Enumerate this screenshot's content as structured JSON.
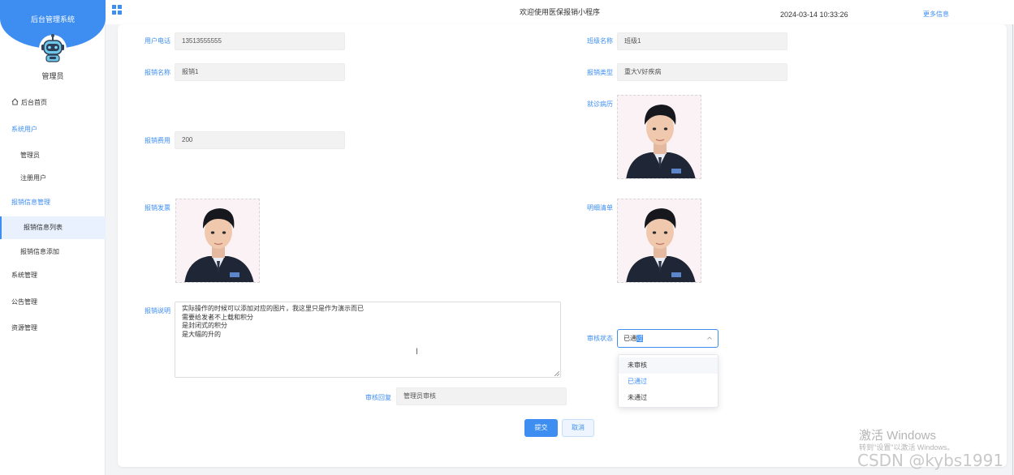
{
  "brand": {
    "title": "后台管理系统",
    "admin_name": "管理员"
  },
  "sidebar": {
    "items": [
      {
        "label": "后台首页"
      },
      {
        "label": "系统用户"
      },
      {
        "label": "管理员"
      },
      {
        "label": "注册用户"
      },
      {
        "label": "报销信息管理"
      },
      {
        "label": "报销信息列表"
      },
      {
        "label": "报销信息添加"
      },
      {
        "label": "系统管理"
      },
      {
        "label": "公告管理"
      },
      {
        "label": "资源管理"
      }
    ]
  },
  "topbar": {
    "welcome": "欢迎使用医保报销小程序",
    "datetime": "2024-03-14 10:33:26",
    "more_info": "更多信息"
  },
  "form": {
    "phone": {
      "label": "用户电话",
      "value": "13513555555"
    },
    "class": {
      "label": "班级名称",
      "value": "班级1"
    },
    "reimb_name": {
      "label": "报销名称",
      "value": "报销1"
    },
    "reimb_type": {
      "label": "报销类型",
      "value": "重大V好疾病"
    },
    "medical_record": {
      "label": "就诊病历"
    },
    "fee": {
      "label": "报销费用",
      "value": "200"
    },
    "invoice": {
      "label": "报销发票"
    },
    "detail_list": {
      "label": "明细清单"
    },
    "description": {
      "label": "报销说明",
      "lines": [
        "实际操作的时候可以添加对应的图片，我这里只是作为演示而已",
        "需要给发者不上载和积分",
        "是封闭式的积分",
        "是大幅的升的"
      ]
    },
    "audit_status": {
      "label": "审核状态",
      "value_prefix": "已通",
      "value_highlight": "过",
      "options": [
        "未审核",
        "已通过",
        "未通过"
      ]
    },
    "audit_reply": {
      "label": "审核回复",
      "value": "管理员审核"
    }
  },
  "buttons": {
    "submit": "提交",
    "cancel": "取消"
  },
  "watermark": {
    "title": "激活 Windows",
    "subtitle": "转到\"设置\"以激活 Windows。",
    "csdn": "CSDN @kybs1991"
  },
  "colors": {
    "accent": "#3d8ef0",
    "brand": "#3d8ef0"
  }
}
